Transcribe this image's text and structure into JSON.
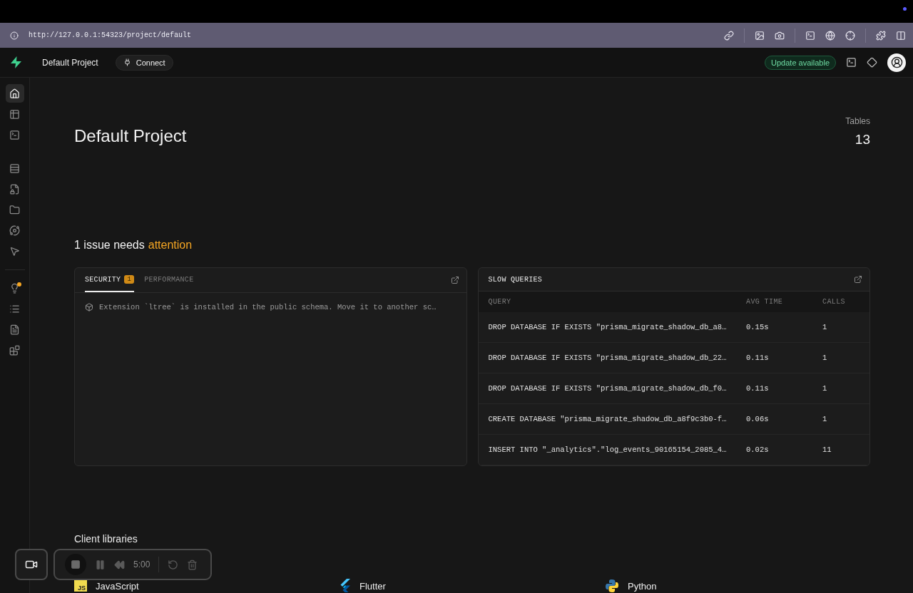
{
  "browser": {
    "url": "http://127.0.0.1:54323/project/default"
  },
  "header": {
    "project": "Default Project",
    "connect": "Connect",
    "update": "Update available"
  },
  "sidebar": {
    "items": [
      {
        "selected": true,
        "alert": false
      },
      {
        "selected": false,
        "alert": false
      },
      {
        "selected": false,
        "alert": false
      },
      {
        "selected": false,
        "alert": false
      },
      {
        "selected": false,
        "alert": false
      },
      {
        "selected": false,
        "alert": false
      },
      {
        "selected": false,
        "alert": false
      },
      {
        "selected": false,
        "alert": false
      },
      {
        "selected": false,
        "alert": true
      },
      {
        "selected": false,
        "alert": false
      },
      {
        "selected": false,
        "alert": false
      },
      {
        "selected": false,
        "alert": false
      }
    ]
  },
  "project": {
    "title": "Default Project",
    "stat": {
      "label": "Tables",
      "value": "13"
    }
  },
  "issues": {
    "heading": "1 issue needs",
    "highlight": "attention"
  },
  "advisor": {
    "tabs": [
      {
        "label": "SECURITY",
        "count": "1",
        "selected": true
      },
      {
        "label": "PERFORMANCE",
        "selected": false
      }
    ],
    "items": [
      "Extension `ltree` is installed in the public schema. Move it to another sc…"
    ]
  },
  "slow_queries": {
    "title": "SLOW QUERIES",
    "columns": [
      "QUERY",
      "AVG TIME",
      "CALLS"
    ],
    "rows": [
      [
        "DROP DATABASE IF EXISTS \"prisma_migrate_shadow_db_a8…",
        "0.15s",
        "1"
      ],
      [
        "DROP DATABASE IF EXISTS \"prisma_migrate_shadow_db_22…",
        "0.11s",
        "1"
      ],
      [
        "DROP DATABASE IF EXISTS \"prisma_migrate_shadow_db_f0…",
        "0.11s",
        "1"
      ],
      [
        "CREATE DATABASE \"prisma_migrate_shadow_db_a8f9c3b0-f…",
        "0.06s",
        "1"
      ],
      [
        "INSERT INTO \"_analytics\".\"log_events_90165154_2085_4…",
        "0.02s",
        "11"
      ]
    ]
  },
  "client_libraries": {
    "title": "Client libraries",
    "items": [
      {
        "kind": "javascript",
        "name": "JavaScript",
        "logo_text": "JS"
      },
      {
        "kind": "flutter",
        "name": "Flutter"
      },
      {
        "kind": "python",
        "name": "Python"
      }
    ]
  },
  "recorder": {
    "time": "5:00"
  }
}
